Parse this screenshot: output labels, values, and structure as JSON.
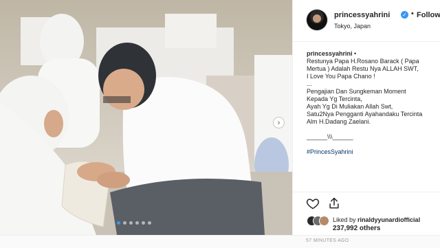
{
  "header": {
    "username": "princessyahrini",
    "separator": "•",
    "follow_status": "Following",
    "location": "Tokyo, Japan",
    "verified": true
  },
  "caption": {
    "username": "princessyahrini",
    "separator": "•",
    "lines": [
      "Restunya Papa H.Rosano Barack ( Papa",
      "Mertua ) Adalah Restu Nya ALLAH SWT,",
      "I Love You Papa Chano !",
      "...",
      "Pengajian Dan Sungkeman Moment",
      "Kepada Yg Tercinta,",
      "Ayah Yg Di Muliakan Allah Swt,",
      "Satu2Nya Pengganti Ayahandaku Tercinta",
      "Alm H.Dadang Zaelani.",
      "",
      "______\\\\\\______",
      "",
      "#PrincesSyahrini"
    ],
    "hashtag": "#PrincesSyahrini"
  },
  "engagement": {
    "liked_by_prefix": "Liked by",
    "liked_by_user": "rinaldyyunardiofficial",
    "like_count": "237,992 others",
    "timestamp": "57 MINUTES AGO"
  },
  "carousel": {
    "slide_count": 6,
    "active_index": 0
  },
  "icons": {
    "verified": "verified-badge-icon",
    "heart": "heart-icon",
    "share": "share-icon",
    "next": "chevron-right-icon"
  },
  "colors": {
    "accent_blue": "#3897f0",
    "text": "#262626",
    "muted": "#999999",
    "hashtag": "#003569"
  }
}
